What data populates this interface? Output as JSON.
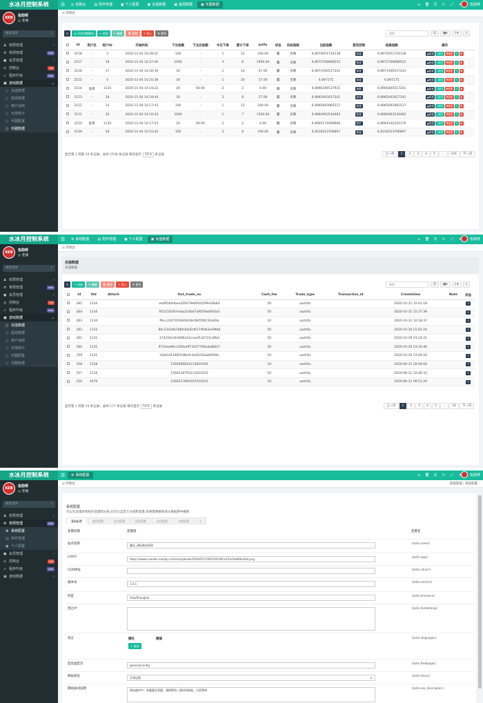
{
  "app": {
    "brand": "水冰月控制系统",
    "user": "佐助呀",
    "status": "在线",
    "avatar_text": "KEB",
    "search_placeholder": "搜索菜单"
  },
  "colors": {
    "primary": "#18bc9c",
    "sidebar": "#222d32",
    "dark": "#2c3e50",
    "danger": "#e74c3c"
  },
  "panel1": {
    "tabs": [
      "控制台",
      "附件管理",
      "个人配置",
      "充值数据",
      "提现数据",
      "币圈数据"
    ],
    "menu": [
      {
        "label": "权限管理",
        "icon": "users-icon"
      },
      {
        "label": "常规管理",
        "icon": "cogs-icon",
        "badge": "new"
      },
      {
        "label": "会员管理",
        "icon": "user-icon"
      },
      {
        "label": "控制台",
        "icon": "dashboard-icon",
        "badge": "hot"
      },
      {
        "label": "程序升级",
        "icon": "rocket-icon",
        "badge": "new"
      },
      {
        "label": "游戏数据",
        "icon": "gamepad-icon"
      },
      {
        "label": "充值数据",
        "icon": "circle-icon"
      },
      {
        "label": "提现数据",
        "icon": "circle-icon"
      },
      {
        "label": "用户战绩",
        "icon": "circle-icon"
      },
      {
        "label": "日常统计",
        "icon": "circle-icon"
      },
      {
        "label": "币圈配置",
        "icon": "circle-icon"
      },
      {
        "label": "币圈数据",
        "icon": "circle-icon"
      }
    ],
    "crumb": "控制台",
    "toolbar": [
      "",
      "开关切换模式",
      "添加",
      "编辑",
      "删除",
      "导入",
      "更多"
    ],
    "search": "搜索",
    "columns": [
      "Id",
      "用户名",
      "用户ID",
      "开始时间",
      "下注金额",
      "下注后金额",
      "今日下单",
      "累计下单",
      "pollu",
      "状态",
      "目标涨跌",
      "当前指数",
      "是否控制",
      "结果指数",
      "操作"
    ],
    "rows": [
      [
        "2158",
        "-",
        "3",
        "2020-11-04 14:28:41",
        "100",
        "-",
        "1",
        "12",
        "190.00",
        "赢",
        "买跌",
        "6.8974051724138",
        "收涨",
        "6.8974051724138"
      ],
      [
        "2157",
        "-",
        "18",
        "2020-11-04 14:27:40",
        "1000",
        "-",
        "3",
        "8",
        "1900.00",
        "赢",
        "买跌",
        "6.8972766896552",
        "收涨",
        "6.8972766896552"
      ],
      [
        "2156",
        "-",
        "17",
        "2020-11-04 14:26:39",
        "30",
        "-",
        "1",
        "15",
        "57.00",
        "赢",
        "买跌",
        "6.8971590517241",
        "收涨",
        "6.8971590517241"
      ],
      [
        "2155",
        "-",
        "4",
        "2020-11-04 14:25:38",
        "30",
        "-",
        "1",
        "10",
        "57.00",
        "赢",
        "买跌",
        "6.897175",
        "收涨",
        "6.897175"
      ],
      [
        "2154",
        "鱼哥",
        "1135",
        "2020-11-04 14:19:22",
        "20",
        "60.00",
        "2",
        "2",
        "0.00",
        "输",
        "买跌",
        "6.8966349137931",
        "收跌",
        "6.8965840517241"
      ],
      [
        "2153",
        "-",
        "18",
        "2020-11-04 14:18:44",
        "30",
        "-",
        "3",
        "8",
        "57.00",
        "赢",
        "买跌",
        "6.8965403017241",
        "收涨",
        "6.8965403017241"
      ],
      [
        "2152",
        "-",
        "14",
        "2020-11-04 14:17:43",
        "100",
        "-",
        "1",
        "13",
        "190.00",
        "赢",
        "买跌",
        "6.8965693965517",
        "收涨",
        "6.8965693965517"
      ],
      [
        "2151",
        "-",
        "16",
        "2020-11-04 14:16:43",
        "1000",
        "-",
        "1",
        "7",
        "1500.00",
        "赢",
        "买跌",
        "6.8964963534483",
        "收涨",
        "6.8964963534483"
      ],
      [
        "2150",
        "鱼哥",
        "1135",
        "2020-11-04 14:17:03",
        "20",
        "80.00",
        "2",
        "2",
        "0.00",
        "输",
        "买跌",
        "6.8965174568966",
        "收平",
        "6.8964142241379"
      ],
      [
        "2149",
        "-",
        "18",
        "2020-11-04 14:15:42",
        "100",
        "-",
        "3",
        "8",
        "190.00",
        "赢",
        "买跌",
        "6.8318523706897",
        "收涨",
        "6.8318523706897"
      ]
    ],
    "ops": [
      "收涨",
      "收平",
      "收跌"
    ],
    "page_info": "显示第 1 到第 10 条记录，总共 2158 条记录 每页显示",
    "page_size": "10",
    "page_suffix": "条记录",
    "pages": [
      "上一页",
      "1",
      "2",
      "3",
      "4",
      "5",
      "...",
      "216",
      "下一页"
    ]
  },
  "panel2": {
    "tabs": [
      "系统配置",
      "附件管理",
      "个人配置",
      "充值数据"
    ],
    "crumb": "控制台",
    "title": "充值数据",
    "subtitle": "充值数据",
    "toolbar": [
      "",
      "添加",
      "编辑",
      "删除",
      "导入",
      "更多"
    ],
    "search": "搜索",
    "columns": [
      "Id",
      "Uid",
      "Attach",
      "Out_trade_no",
      "Cash_fee",
      "Trade_type",
      "Transaction_id",
      "Createtime",
      "Note",
      "状态"
    ],
    "rows": [
      [
        "265",
        "1134",
        "",
        "ee09184ebea169379b6f0cb5f9e26b64",
        "50",
        "uozhifu",
        "",
        "2020-10-31 15:41:18"
      ],
      [
        "264",
        "1134",
        "",
        "955210287edaa2d3bd7a9059ab954a5",
        "50",
        "uozhifu",
        "",
        "2020-10-31 15:37:39"
      ],
      [
        "263",
        "1134",
        "",
        "ffecc2d27054840438cfb05f6fc5da09a",
        "10",
        "uozhifu",
        "",
        "2020-10-31 10:18:37"
      ],
      [
        "262",
        "1133",
        "",
        "86c23434b7b8fc84d2d6174fdb3e49fb8",
        "50",
        "uozhifu",
        "",
        "2020-10-30 21:02:24"
      ],
      [
        "261",
        "1131",
        "",
        "17410dcd10486a52cceef1d2722c4fb4",
        "50",
        "uozhifu",
        "",
        "2020-10-29 23:24:21"
      ],
      [
        "260",
        "1131",
        "",
        "972dae96cc028aeff7343774fbabd6627",
        "50",
        "uozhifu",
        "",
        "2020-10-29 23:16:46"
      ],
      [
        "259",
        "1131",
        "",
        "a1bfcd23d81fc8befcda4d33bab0959e",
        "10",
        "uozhifu",
        "",
        "2020-10-29 23:00:24"
      ],
      [
        "258",
        "1128",
        "",
        "1560589644112810195",
        "10",
        "uozhifu",
        "",
        "2019-06-15 20:09:04"
      ],
      [
        "257",
        "1116",
        "",
        "1560218793111610252",
        "10",
        "uozhifu",
        "",
        "2019-06-11 10:06:33"
      ],
      [
        "256",
        "1076",
        "",
        "1560217869107010015",
        "10",
        "uozhifu",
        "",
        "2019-06-11 09:51:29"
      ]
    ],
    "page_info": "显示第 1 到第 10 条记录，总共 177 条记录 每页显示",
    "page_size": "10",
    "page_suffix": "条记录",
    "pages": [
      "上一页",
      "1",
      "2",
      "3",
      "4",
      "5",
      "...",
      "18",
      "下一页"
    ]
  },
  "panel3": {
    "tabs": [
      "系统配置"
    ],
    "crumb": "控制台",
    "crumb_right": [
      "常规管理",
      "系统配置"
    ],
    "title": "系统配置",
    "desc": "可以在此增改系统的变量和分组,也可以自定义分组和变量,如果需要删除请从数据库中删除",
    "cfgtabs": [
      "基础配置",
      "邮件配置",
      "支付配置",
      "提现配置",
      "会员配置",
      "字典配置",
      "+"
    ],
    "head": [
      "变量标题",
      "变量值",
      "变量名"
    ],
    "fields": [
      {
        "label": "站点名称",
        "value": "最近_源码来自码同",
        "var": "{$site.name}"
      },
      {
        "label": "LOGO",
        "value": "https://www.ucaidex.net/wp-content/uploads/2020/07/1595319138-fc431d3a666e2b4.png",
        "var": "{$site.logo}"
      },
      {
        "label": "CDN地址",
        "value": "",
        "var": "{$site.cdnurl}"
      },
      {
        "label": "版本号",
        "value": "1.0.1",
        "var": "{$site.version}"
      },
      {
        "label": "时区",
        "value": "Asia/Shanghai",
        "var": "{$site.timezone}"
      },
      {
        "label": "禁止IP",
        "value": "",
        "var": "{$site.forbiddenip}"
      },
      {
        "label": "语言",
        "value": "",
        "var": "{$site.languages}"
      },
      {
        "label": "后台固定页",
        "value": "general/config",
        "var": "{$site.fixedpage}"
      },
      {
        "label": "网站状态",
        "value": "正常运营",
        "var": "{$site.fclose}"
      },
      {
        "label": "网站关闭说明",
        "value": "网站维护中，有重要东西要，请稍等到一段时间再来。大家等待",
        "var": "{$site.seo_description}"
      }
    ],
    "lang_headers": [
      "键名",
      "键值"
    ],
    "add_btn": "追加"
  }
}
